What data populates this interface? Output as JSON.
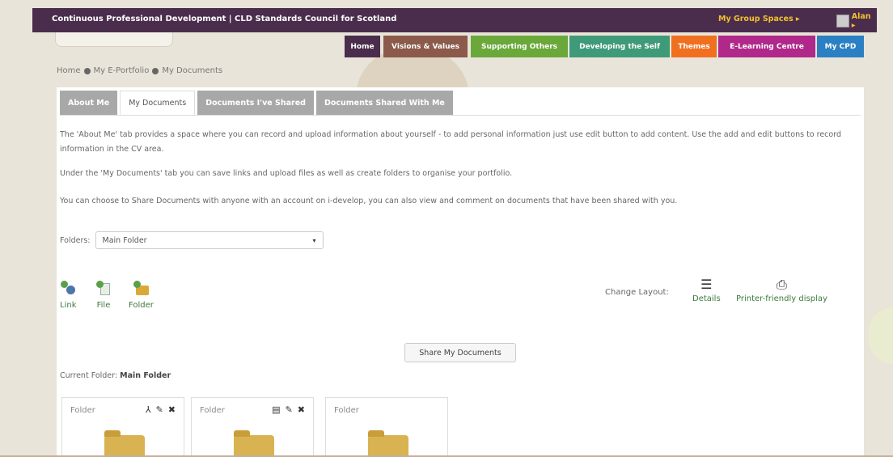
{
  "topbar": {
    "title": "Continuous Professional Development | CLD Standards Council for Scotland",
    "group_spaces": "My Group Spaces ▸",
    "user": "Alan ▸"
  },
  "nav": [
    {
      "label": "Home",
      "color": "#4a2d4c"
    },
    {
      "label": "Visions & Values",
      "color": "#8b5a4a"
    },
    {
      "label": "Supporting Others",
      "color": "#6aa83a"
    },
    {
      "label": "Developing the Self",
      "color": "#3e9a78"
    },
    {
      "label": "Themes",
      "color": "#f07020"
    },
    {
      "label": "E-Learning Centre",
      "color": "#b0288a"
    },
    {
      "label": "My CPD",
      "color": "#2a80c2"
    }
  ],
  "breadcrumb": {
    "home": "Home",
    "portfolio": "My E-Portfolio",
    "documents": "My Documents"
  },
  "tabs": [
    {
      "label": "About Me"
    },
    {
      "label": "My Documents"
    },
    {
      "label": "Documents I've Shared"
    },
    {
      "label": "Documents Shared With Me"
    }
  ],
  "paragraphs": {
    "p1": "The 'About Me' tab provides a space where you can record and upload information about yourself - to add personal information just use edit button to add content. Use the add and edit buttons to record information in the CV area.",
    "p2": "Under the 'My Documents' tab you can save links and upload files as well as create folders to organise your portfolio.",
    "p3": "You can choose to Share Documents with anyone with an account on i-develop, you can also view and comment on documents that have been shared with you."
  },
  "folders": {
    "label": "Folders:",
    "selected": "Main Folder"
  },
  "actions": {
    "link": "Link",
    "file": "File",
    "folder": "Folder"
  },
  "layout": {
    "label": "Change Layout:",
    "details": "Details",
    "printer": "Printer-friendly display"
  },
  "share_button": "Share My Documents",
  "current_folder": {
    "label": "Current Folder:",
    "name": "Main Folder"
  },
  "cards": [
    {
      "label": "Folder"
    },
    {
      "label": "Folder"
    },
    {
      "label": "Folder"
    }
  ]
}
